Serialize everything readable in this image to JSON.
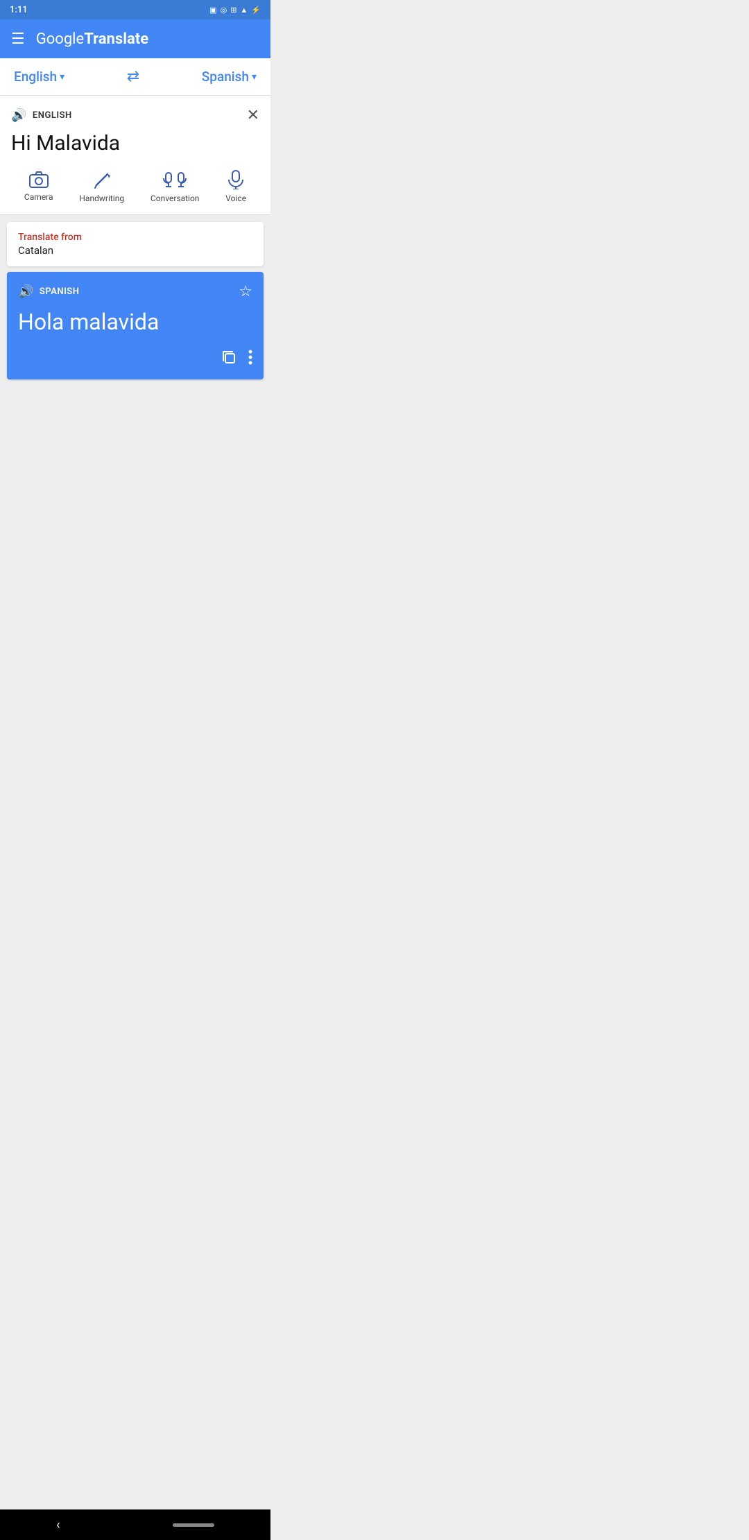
{
  "status": {
    "time": "1:11",
    "icons": [
      "📋",
      "◎",
      "📳",
      "▲",
      "🔋"
    ]
  },
  "header": {
    "menu_icon": "☰",
    "title_google": "Google",
    "title_translate": " Translate"
  },
  "lang_bar": {
    "source_lang": "English",
    "target_lang": "Spanish",
    "swap_icon": "⇄"
  },
  "input_area": {
    "lang_label": "ENGLISH",
    "input_text": "Hi Malavida",
    "close_icon": "✕"
  },
  "tools": [
    {
      "label": "Camera",
      "icon": "📷"
    },
    {
      "label": "Handwriting",
      "icon": "✏"
    },
    {
      "label": "Conversation",
      "icon": "🎙"
    },
    {
      "label": "Voice",
      "icon": "🎤"
    }
  ],
  "translate_from": {
    "label": "Translate from",
    "language": "Catalan"
  },
  "output": {
    "lang_label": "SPANISH",
    "text": "Hola malavida"
  }
}
